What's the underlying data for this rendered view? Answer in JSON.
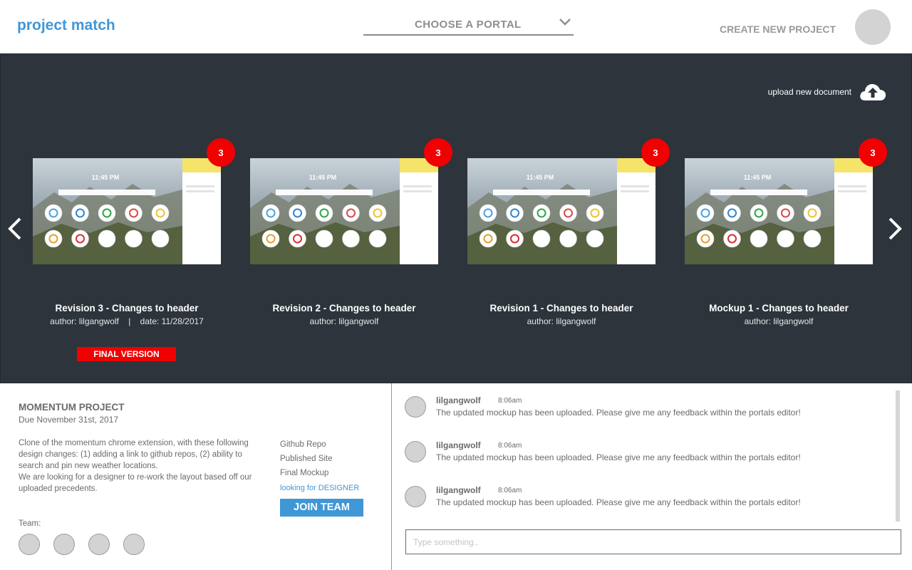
{
  "header": {
    "logo": "project match",
    "portal_label": "CHOOSE A PORTAL",
    "create_label": "CREATE NEW PROJECT"
  },
  "gallery": {
    "upload_label": "upload new document",
    "thumbnail_clock": "11:45 PM",
    "cards": [
      {
        "title": "Revision 3 - Changes to header",
        "meta": "author: lilgangwolf    |    date: 11/28/2017",
        "badge": "3",
        "final": "FINAL VERSION"
      },
      {
        "title": "Revision 2 - Changes to header",
        "meta": "author: lilgangwolf",
        "badge": "3"
      },
      {
        "title": "Revision 1 - Changes to header",
        "meta": "author: lilgangwolf",
        "badge": "3"
      },
      {
        "title": "Mockup 1 - Changes to header",
        "meta": "author: lilgangwolf",
        "badge": "3"
      }
    ]
  },
  "project": {
    "title": "MOMENTUM PROJECT",
    "due": "Due November 31st, 2017",
    "description_1": "Clone of the momentum chrome extension, with these following design changes: (1) adding a link to github repos, (2) ability to search and pin new weather locations.",
    "description_2": "We are looking for a designer to re-work the layout based off our uploaded precedents.",
    "links": [
      "Github Repo",
      "Published Site",
      "Final Mockup"
    ],
    "looking_for": "looking for DESIGNER",
    "join_label": "JOIN TEAM",
    "team_label": "Team:"
  },
  "chat": {
    "messages": [
      {
        "user": "lilgangwolf",
        "time": "8:06am",
        "text": "The updated mockup has been uploaded. Please give me any feedback within the portals editor!"
      },
      {
        "user": "lilgangwolf",
        "time": "8:06am",
        "text": "The updated mockup has been uploaded. Please give me any feedback within the portals editor!"
      },
      {
        "user": "lilgangwolf",
        "time": "8:06am",
        "text": "The updated mockup has been uploaded. Please give me any feedback within the portals editor!"
      }
    ],
    "input_placeholder": "Type something.."
  },
  "colors": {
    "brand_blue": "#3f97d6",
    "dark_panel": "#2d343c",
    "badge_red": "#f00000"
  }
}
